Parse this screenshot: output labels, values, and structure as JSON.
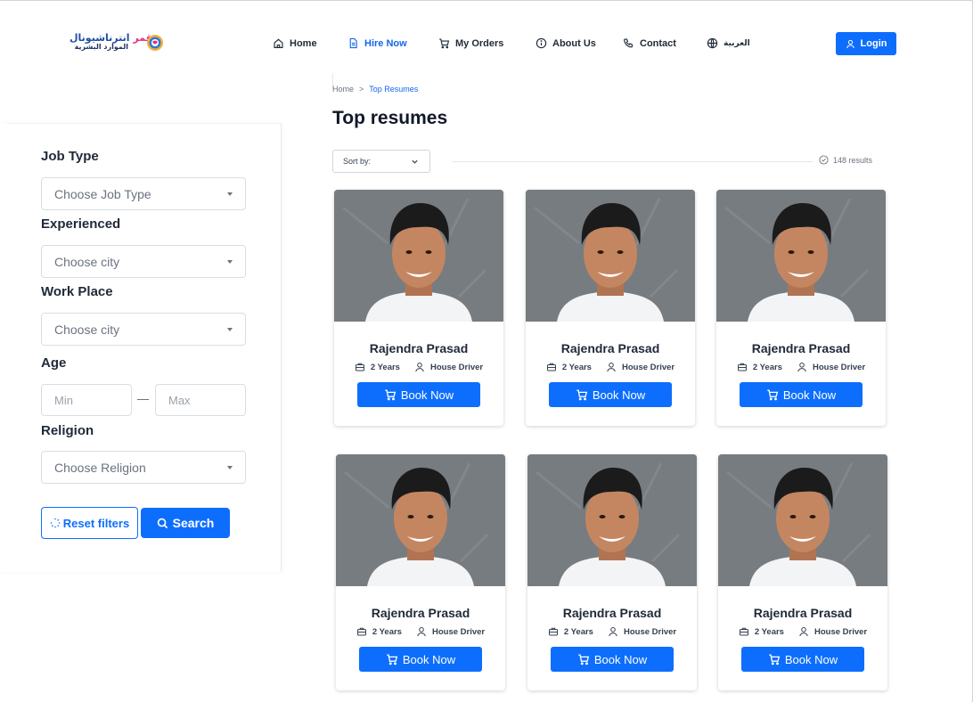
{
  "header": {
    "logo": {
      "line1_a": "قمر",
      "line1_b": "انترناشيونال",
      "line2": "الموارد البشرية"
    },
    "nav": [
      {
        "label": "Home",
        "icon": "home-icon",
        "active": false
      },
      {
        "label": "Hire Now",
        "icon": "document-icon",
        "active": true
      },
      {
        "label": "My Orders",
        "icon": "cart-icon",
        "active": false
      },
      {
        "label": "About Us",
        "icon": "info-icon",
        "active": false
      },
      {
        "label": "Contact",
        "icon": "phone-icon",
        "active": false
      },
      {
        "label": "العربية",
        "icon": "globe-icon",
        "active": false
      }
    ],
    "login_label": "Login"
  },
  "breadcrumb": {
    "home": "Home",
    "separator": ">",
    "current": "Top Resumes"
  },
  "page_title": "Top resumes",
  "sort": {
    "label": "Sort by:",
    "results": "148 results"
  },
  "filters": {
    "job_type": {
      "label": "Job Type",
      "placeholder": "Choose Job Type"
    },
    "experienced": {
      "label": "Experienced",
      "placeholder": "Choose city"
    },
    "work_place": {
      "label": "Work Place",
      "placeholder": "Choose city"
    },
    "age": {
      "label": "Age",
      "min_placeholder": "Min",
      "max_placeholder": "Max"
    },
    "religion": {
      "label": "Religion",
      "placeholder": "Choose Religion"
    },
    "reset_label": "Reset filters",
    "search_label": "Search"
  },
  "cards": [
    {
      "name": "Rajendra Prasad",
      "experience": "2 Years",
      "role": "House Driver",
      "button": "Book Now"
    },
    {
      "name": "Rajendra Prasad",
      "experience": "2 Years",
      "role": "House Driver",
      "button": "Book Now"
    },
    {
      "name": "Rajendra Prasad",
      "experience": "2 Years",
      "role": "House Driver",
      "button": "Book Now"
    },
    {
      "name": "Rajendra Prasad",
      "experience": "2 Years",
      "role": "House Driver",
      "button": "Book Now"
    },
    {
      "name": "Rajendra Prasad",
      "experience": "2 Years",
      "role": "House Driver",
      "button": "Book Now"
    },
    {
      "name": "Rajendra Prasad",
      "experience": "2 Years",
      "role": "House Driver",
      "button": "Book Now"
    }
  ],
  "colors": {
    "primary": "#0d6efd",
    "active_nav": "#1467ea",
    "text": "#1f2937",
    "logo_pink": "#e0317a",
    "logo_blue": "#1f4fa3"
  }
}
